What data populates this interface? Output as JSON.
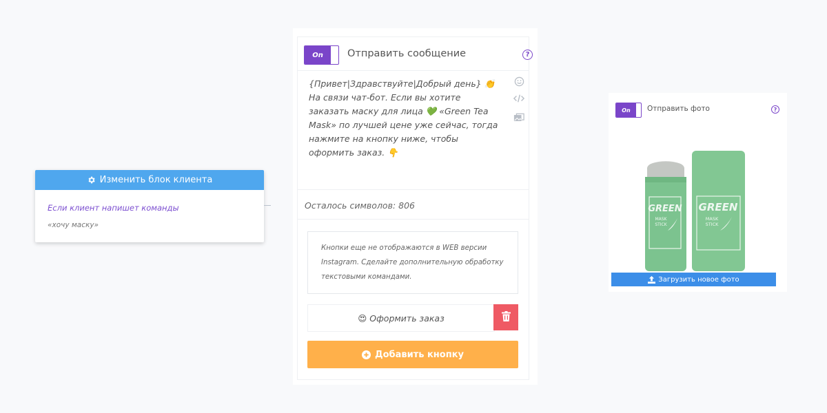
{
  "client_block": {
    "header_label": "Изменить блок клиента",
    "condition_text": "Если клиент напишет команды",
    "command_text": "«хочу маску»"
  },
  "message_block": {
    "toggle_label": "On",
    "title": "Отправить сообщение",
    "help_symbol": "?",
    "message_text": "{Привет|Здравствуйте|Добрый день} 👏\nНа связи чат-бот. Если вы хотите заказать маску для лица 💚 «Green Tea Mask» по лучшей цене уже сейчас, тогда нажмите на кнопку ниже, чтобы оформить заказ. 👇",
    "remaining_chars": "Осталось символов: 806",
    "note_text": "Кнопки еще не отображаются в WEB версии Instagram. Сделайте дополнительную обработку текстовыми командами.",
    "order_button_label": "😍 Оформить заказ",
    "add_button_label": "Добавить кнопку"
  },
  "photo_block": {
    "toggle_label": "On",
    "title": "Отправить фото",
    "help_symbol": "?",
    "upload_button_label": "Загрузить новое фото",
    "product_label_main": "GREEN",
    "product_label_sub1": "MASK",
    "product_label_sub2": "STICK"
  },
  "colors": {
    "purple": "#7a45c9",
    "blue_header": "#4fa7ee",
    "red_delete": "#ef5a64",
    "orange_add": "#ffb04a",
    "blue_upload": "#3c8ee8",
    "product_green": "#7cc38f"
  },
  "icons": [
    "gear-icon",
    "emoji-icon",
    "code-icon",
    "images-icon",
    "trash-icon",
    "plus-circle-icon",
    "upload-icon"
  ]
}
